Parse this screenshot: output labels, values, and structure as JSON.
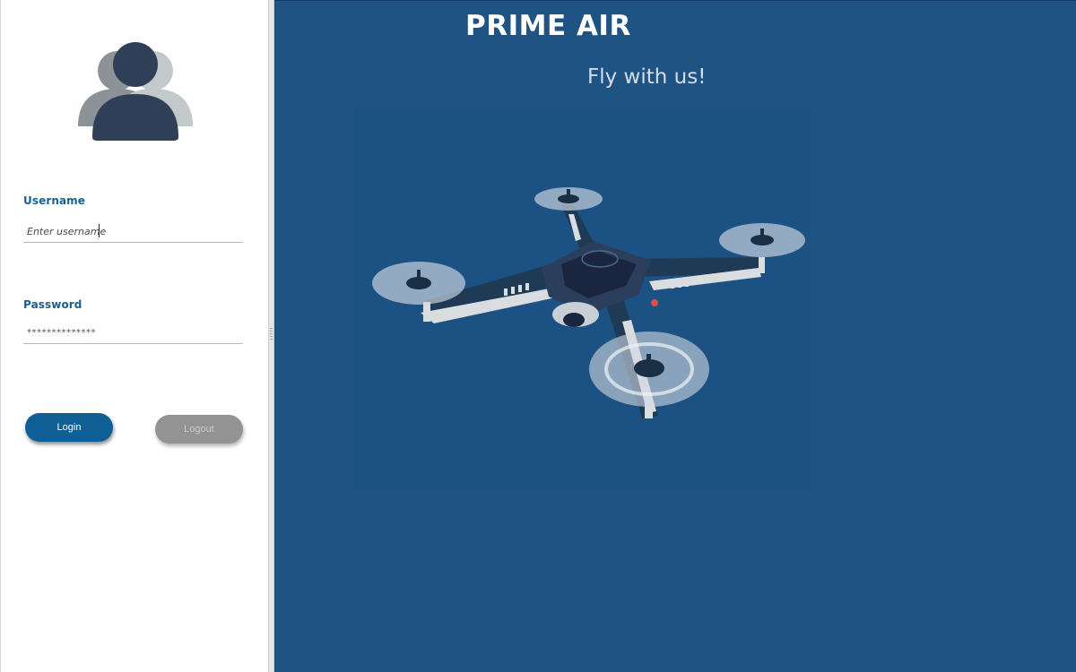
{
  "login": {
    "username_label": "Username",
    "username_placeholder": "Enter username",
    "password_label": "Password",
    "password_value": "**************",
    "login_button": "Login",
    "logout_button": "Logout"
  },
  "hero": {
    "title": "PRIME AIR",
    "subtitle": "Fly with us!"
  },
  "icons": {
    "avatar": "users-group-icon",
    "illustration": "quadcopter-drone-illustration"
  },
  "colors": {
    "hero_background": "#1f5384",
    "label_color": "#1a5f8e",
    "login_button": "#0f5f96",
    "logout_button_disabled": "#939393"
  }
}
